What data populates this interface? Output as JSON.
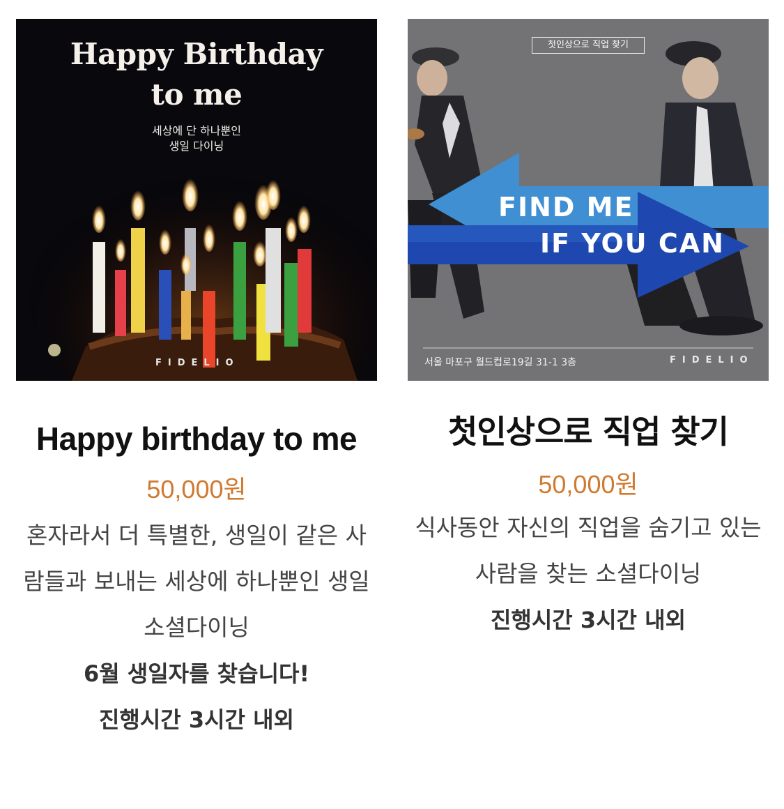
{
  "products": [
    {
      "image": {
        "title_line1": "Happy Birthday",
        "title_line2": "to me",
        "subtitle_line1": "세상에 단 하나뿐인",
        "subtitle_line2": "생일 다이닝",
        "brand": "FIDELIO"
      },
      "name": "Happy birthday to me",
      "price": "50,000원",
      "description": "혼자라서 더 특별한, 생일이 같은 사람들과 보내는 세상에 하나뿐인 생일 소셜다이닝",
      "highlight": "6월 생일자를 찾습니다!",
      "duration": "진행시간 3시간 내외"
    },
    {
      "image": {
        "tag": "첫인상으로 직업 찾기",
        "headline_line1": "FIND ME",
        "headline_line2": "IF YOU CAN",
        "address": "서울 마포구 월드컵로19길 31-1 3층",
        "brand": "FIDELIO"
      },
      "name": "첫인상으로 직업 찾기",
      "price": "50,000원",
      "description": "식사동안 자신의 직업을 숨기고 있는 사람을 찾는 소셜다이닝",
      "duration": "진행시간 3시간 내외"
    }
  ],
  "colors": {
    "price": "#d07a30",
    "arrow_light": "#3f8fd2",
    "arrow_dark": "#1f47b0"
  }
}
